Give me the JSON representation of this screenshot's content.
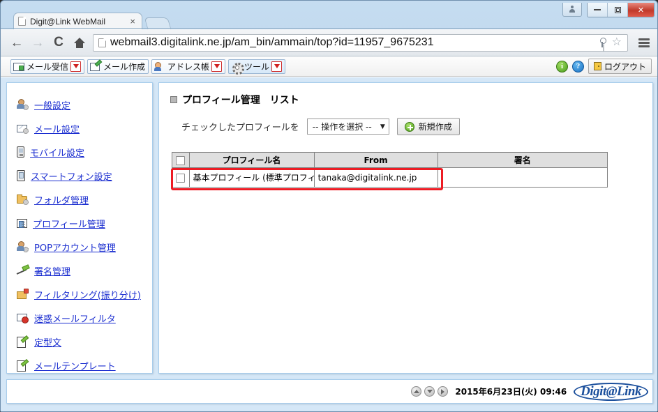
{
  "browser": {
    "tab": {
      "title": "Digit@Link WebMail",
      "close_label": "×",
      "icon": "page-icon"
    },
    "nav": {
      "back_icon": "back-arrow-icon",
      "forward_icon": "forward-arrow-icon",
      "reload_icon": "reload-icon",
      "home_icon": "home-icon",
      "key_icon": "key-icon",
      "star_icon": "star-icon",
      "menu_icon": "hamburger-menu-icon"
    },
    "url": {
      "host": "webmail3.digitalink.ne.jp",
      "path": "/am_bin/ammain/top?id=11957_9675231",
      "full": "webmail3.digitalink.ne.jp/am_bin/ammain/top?id=11957_9675231"
    },
    "window_controls": {
      "user_icon": "user-icon",
      "minimize": "—",
      "maximize": "□",
      "close": "✕"
    }
  },
  "toolbar": {
    "buttons": [
      {
        "label": "メール受信",
        "icon": "receive-mail-icon",
        "has_caret": true
      },
      {
        "label": "メール作成",
        "icon": "compose-mail-icon",
        "has_caret": false
      },
      {
        "label": "アドレス帳",
        "icon": "address-book-icon",
        "has_caret": true
      },
      {
        "label": "ツール",
        "icon": "tools-gear-icon",
        "has_caret": true
      }
    ],
    "info_label": "i",
    "help_label": "?",
    "logout_label": "ログアウト"
  },
  "sidebar": {
    "items": [
      {
        "label": "一般設定",
        "icon": "general-settings-icon"
      },
      {
        "label": "メール設定",
        "icon": "mail-settings-icon"
      },
      {
        "label": "モバイル設定",
        "icon": "mobile-settings-icon"
      },
      {
        "label": "スマートフォン設定",
        "icon": "smartphone-settings-icon"
      },
      {
        "label": "フォルダ管理",
        "icon": "folder-management-icon"
      },
      {
        "label": "プロフィール管理",
        "icon": "profile-management-icon"
      },
      {
        "label": "POPアカウント管理",
        "icon": "pop-account-icon"
      },
      {
        "label": "署名管理",
        "icon": "signature-pen-icon"
      },
      {
        "label": "フィルタリング(振り分け)",
        "icon": "filtering-icon"
      },
      {
        "label": "迷惑メールフィルタ",
        "icon": "spam-filter-icon"
      },
      {
        "label": "定型文",
        "icon": "template-text-icon"
      },
      {
        "label": "メールテンプレート",
        "icon": "mail-template-icon"
      }
    ]
  },
  "main": {
    "title": "プロフィール管理　リスト",
    "action_label": "チェックしたプロフィールを",
    "action_select": {
      "selected": "-- 操作を選択 --",
      "caret": "▼"
    },
    "new_button": "新規作成",
    "table": {
      "headers": [
        "",
        "プロフィール名",
        "From",
        "署名"
      ],
      "rows": [
        {
          "checked": false,
          "name": "基本プロフィール (標準プロフィ",
          "from": "tanaka@digitalink.ne.jp",
          "signature": ""
        }
      ]
    },
    "highlight_color": "#ed1c24"
  },
  "footer": {
    "nav_icons": [
      "scroll-up-icon",
      "scroll-down-icon",
      "scroll-right-icon"
    ],
    "timestamp": "2015年6月23日(火) 09:46",
    "brand": "Digit@Link"
  }
}
